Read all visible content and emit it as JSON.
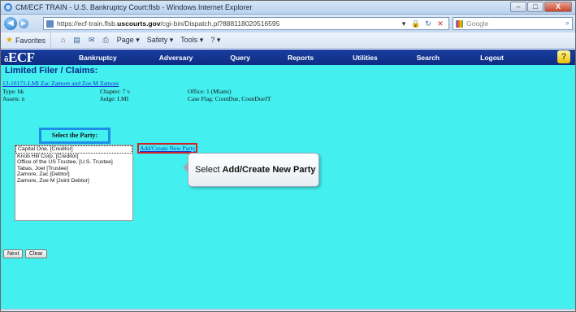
{
  "window": {
    "title": "CM/ECF TRAIN - U.S. Bankruptcy Court:flsb - Windows Internet Explorer",
    "minimize": "–",
    "maximize": "□",
    "close": "X"
  },
  "address_bar": {
    "url_prefix": "https://ecf-train.flsb.",
    "url_domain": "uscourts.gov",
    "url_suffix": "/cgi-bin/Dispatch.pl?888118020516595",
    "search_placeholder": "Google"
  },
  "command_bar": {
    "favorites": "Favorites",
    "page": "Page ▾",
    "safety": "Safety ▾",
    "tools": "Tools ▾",
    "help": "? ▾"
  },
  "ecf": {
    "logo": "ECF",
    "menu": [
      "Bankruptcy",
      "Adversary",
      "Query",
      "Reports",
      "Utilities",
      "Search",
      "Logout"
    ],
    "help_glyph": "?"
  },
  "page": {
    "heading": "Limited Filer / Claims:",
    "case_link": "13-10171-LMI Zac Zamore and Zoe M Zamore",
    "type": "Type: bk",
    "chapter": "Chapter: 7 v",
    "office": "Office: 1 (Miami)",
    "assets": "Assets: n",
    "judge": "Judge: LMI",
    "case_flag": "Case Flag: CounDue, CounDueJT",
    "select_party_label": "Select the Party:",
    "parties": [
      "Capital One, [Creditor]",
      "Knob Hill Corp, [Creditor]",
      "Office of the US Trustee, [U.S. Trustee]",
      "Tabas, Joel [Trustee]",
      "Zamore, Zac [Debtor]",
      "Zamore, Zoe M [Joint Debtor]"
    ],
    "add_party_link": "Add/Create New Party",
    "next_button": "Next",
    "clear_button": "Clear"
  },
  "callout": {
    "prefix": "Select",
    "bold": "Add/Create New Party"
  }
}
